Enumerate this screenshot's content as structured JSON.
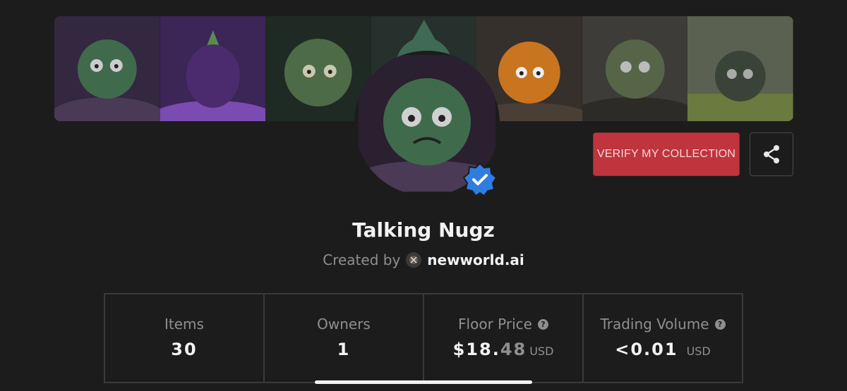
{
  "banner": {
    "tiles": [
      {
        "name": "nug-green-grumpy",
        "bg": "#3a2d44",
        "body": "#3f6b4c"
      },
      {
        "name": "nug-purple",
        "bg": "#4a2d66",
        "body": "#4b2b6e"
      },
      {
        "name": "nug-green-spiky",
        "bg": "#23302a",
        "body": "#4d6b46"
      },
      {
        "name": "nug-green-leafy",
        "bg": "#2a3532",
        "body": "#3f6a55"
      },
      {
        "name": "nug-orange",
        "bg": "#3b3430",
        "body": "#c9741f"
      },
      {
        "name": "nug-green-rocks",
        "bg": "#3a3a38",
        "body": "#566548"
      },
      {
        "name": "nug-dark-grass",
        "bg": "#5c6450",
        "body": "#3a4337"
      }
    ]
  },
  "verify_button": {
    "label": "VERIFY MY COLLECTION"
  },
  "share_button": {
    "icon": "share-icon"
  },
  "collection": {
    "title": "Talking Nugz",
    "created_by_label": "Created by",
    "creator": "newworld.ai",
    "verified_icon": "verified-badge-icon"
  },
  "stats": {
    "items": {
      "label": "Items",
      "value": "30"
    },
    "owners": {
      "label": "Owners",
      "value": "1"
    },
    "floor_price": {
      "label": "Floor Price",
      "value_main": "$18.",
      "value_cents": "48",
      "unit": "USD"
    },
    "trading_volume": {
      "label": "Trading Volume",
      "value": "<0.01",
      "unit": "USD"
    }
  },
  "colors": {
    "accent": "#c0343d",
    "verified": "#2f7de1",
    "background": "#1c1c1c"
  }
}
